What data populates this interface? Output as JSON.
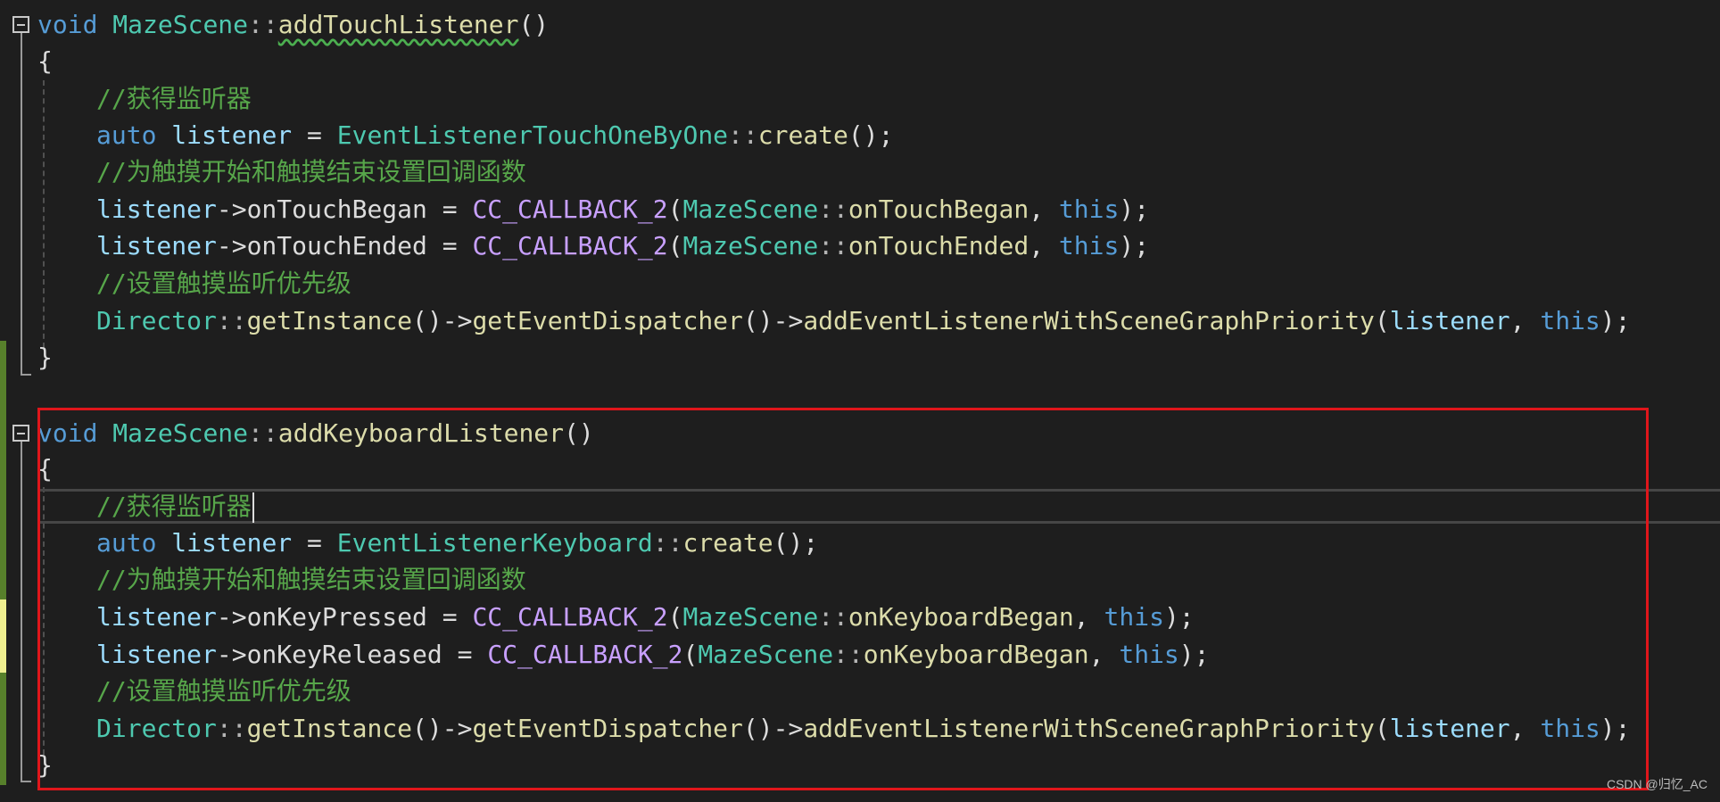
{
  "colors": {
    "background": "#1e1e1e",
    "keyword": "#569cd6",
    "type": "#4ec9b0",
    "function": "#dcdcaa",
    "variable": "#9cdcfe",
    "macro": "#bd63c5",
    "comment": "#57a64a",
    "highlight_box": "#e0161b",
    "gutter_changed": "#57802b",
    "gutter_modified": "#efef90"
  },
  "function1": {
    "ret": "void",
    "cls": "MazeScene",
    "sep": "::",
    "name": "addTouchListener",
    "parens": "()",
    "open": "{",
    "comment1": "//获得监听器",
    "auto": "auto",
    "listener": "listener",
    "eq": " = ",
    "creator": "EventListenerTouchOneByOne",
    "create": "create",
    "create_tail": "();",
    "comment2": "//为触摸开始和触摸结束设置回调函数",
    "arrow": "->",
    "prop1": "onTouchBegan",
    "macro": "CC_CALLBACK_2",
    "lp": "(",
    "cb1": "onTouchBegan",
    "comma": ", ",
    "this": "this",
    "rp_end": ");",
    "prop2": "onTouchEnded",
    "cb2": "onTouchEnded",
    "comment3": "//设置触摸监听优先级",
    "director": "Director",
    "get_instance": "getInstance",
    "dispatcher": "getEventDispatcher",
    "add_listener": "addEventListenerWithSceneGraphPriority",
    "call_parens": "()",
    "close": "}"
  },
  "function2": {
    "ret": "void",
    "cls": "MazeScene",
    "sep": "::",
    "name": "addKeyboardListener",
    "parens": "()",
    "open": "{",
    "comment1": "//获得监听器",
    "auto": "auto",
    "listener": "listener",
    "eq": " = ",
    "creator": "EventListenerKeyboard",
    "create": "create",
    "create_tail": "();",
    "comment2": "//为触摸开始和触摸结束设置回调函数",
    "arrow": "->",
    "prop1": "onKeyPressed",
    "macro": "CC_CALLBACK_2",
    "lp": "(",
    "cb1": "onKeyboardBegan",
    "comma": ", ",
    "this": "this",
    "rp_end": ");",
    "prop2": "onKeyReleased",
    "cb2": "onKeyboardBegan",
    "comment3": "//设置触摸监听优先级",
    "director": "Director",
    "get_instance": "getInstance",
    "dispatcher": "getEventDispatcher",
    "add_listener": "addEventListenerWithSceneGraphPriority",
    "call_parens": "()",
    "close": "}"
  },
  "watermark": "CSDN @归忆_AC"
}
